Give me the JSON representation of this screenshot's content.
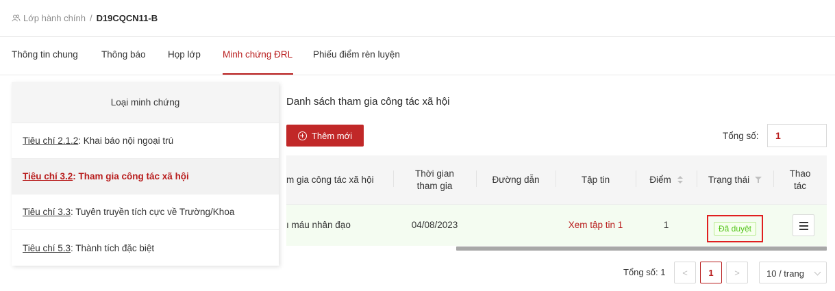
{
  "breadcrumb": {
    "parent": "Lớp hành chính",
    "separator": "/",
    "current": "D19CQCN11-B"
  },
  "tabs": [
    {
      "label": "Thông tin chung"
    },
    {
      "label": "Thông báo"
    },
    {
      "label": "Họp lớp"
    },
    {
      "label": "Minh chứng ĐRL",
      "active": true
    },
    {
      "label": "Phiếu điểm rèn luyện"
    }
  ],
  "criteria_panel": {
    "header": "Loại minh chứng",
    "items": [
      {
        "code": "Tiêu chí 2.1.2",
        "text": ": Khai báo nội ngoại trú"
      },
      {
        "code": "Tiêu chí 3.2",
        "text": ": Tham gia công tác xã hội",
        "active": true
      },
      {
        "code": "Tiêu chí 3.3",
        "text": ": Tuyên truyền tích cực về Trường/Khoa"
      },
      {
        "code": "Tiêu chí 5.3",
        "text": ": Thành tích đặc biệt"
      }
    ]
  },
  "content": {
    "title": "Danh sách tham gia công tác xã hội",
    "add_button": "Thêm mới",
    "total_label": "Tổng số:",
    "total_value": "1",
    "table": {
      "headers": {
        "activity": "m gia công tác xã hội",
        "time_line1": "Thời gian",
        "time_line2": "tham gia",
        "link": "Đường dẫn",
        "file": "Tập tin",
        "score": "Điểm",
        "status": "Trạng thái",
        "action_line1": "Thao",
        "action_line2": "tác"
      },
      "rows": [
        {
          "activity": "ı máu nhân đạo",
          "time": "04/08/2023",
          "link": "",
          "file": "Xem tập tin 1",
          "score": "1",
          "status": "Đã duyệt"
        }
      ]
    }
  },
  "pagination": {
    "total_text": "Tổng số: 1",
    "prev": "<",
    "current_page": "1",
    "next": ">",
    "page_size": "10 / trang"
  },
  "colors": {
    "accent": "#b81c1c",
    "button_bg": "#c12828",
    "approved_tag": "#52c41a",
    "highlight_box": "#e01f1f"
  }
}
